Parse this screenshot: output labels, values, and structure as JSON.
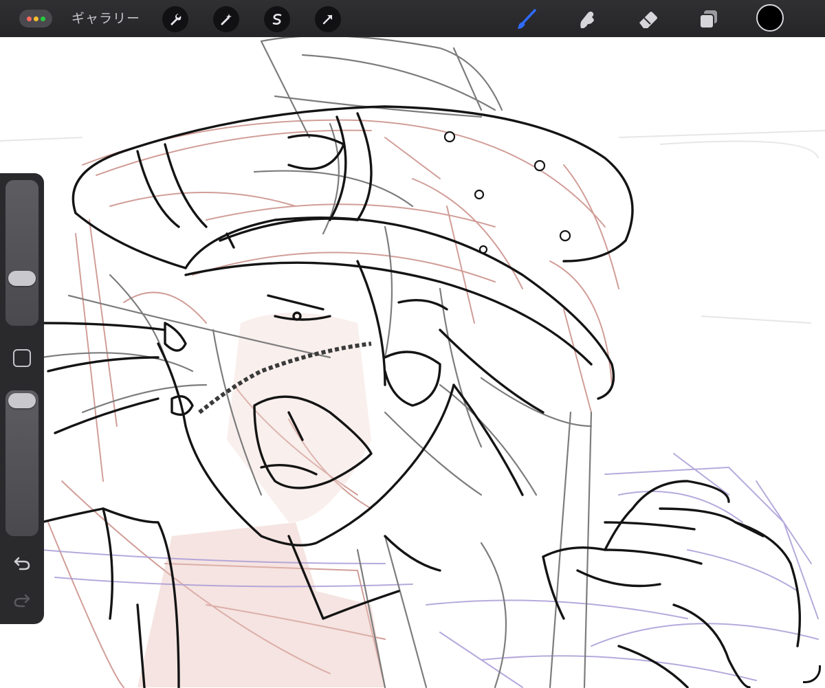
{
  "app": {
    "gallery_label": "ギャラリー"
  },
  "toolbar_left": {
    "icons": [
      "menu-dots-icon",
      "wrench-icon",
      "magic-wand-icon",
      "selection-s-icon",
      "arrow-transform-icon"
    ]
  },
  "toolbar_right": {
    "icons": [
      "brush-icon",
      "smudge-icon",
      "eraser-icon",
      "layers-icon"
    ],
    "active_tool": "brush",
    "active_color": "#000000",
    "accent_color": "#2f6bff"
  },
  "sidebar": {
    "brush_size": 0.35,
    "opacity": 0.95,
    "icons": [
      "modify-square-icon",
      "undo-icon",
      "redo-icon"
    ]
  },
  "canvas": {
    "background": "#ffffff",
    "layers_colors": [
      "#c98d86",
      "#a99bd6",
      "#888888",
      "#111111"
    ]
  }
}
